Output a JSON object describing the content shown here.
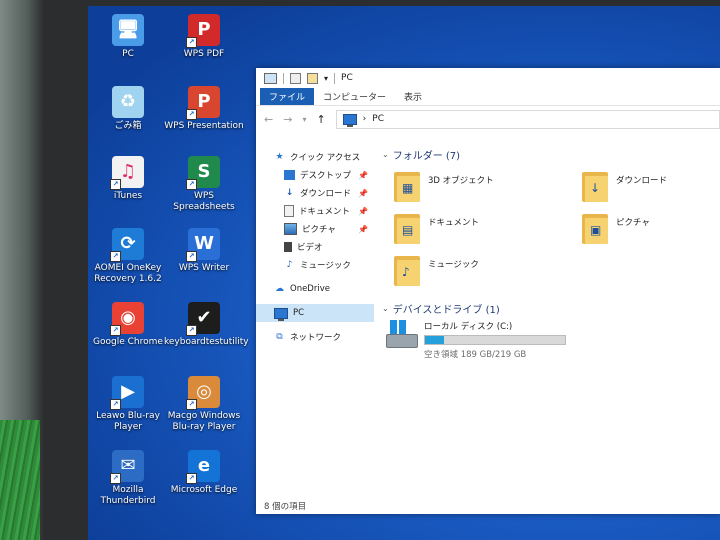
{
  "desktop": {
    "icons": [
      {
        "label": "PC",
        "icon": "pc-icon",
        "color": "#4a9be8",
        "glyph": "🖥",
        "shortcut": false
      },
      {
        "label": "WPS PDF",
        "icon": "wps-pdf-icon",
        "color": "#d22a2a",
        "glyph": "P",
        "shortcut": true
      },
      {
        "label": "ごみ箱",
        "icon": "recycle-bin-icon",
        "color": "#9fd3f0",
        "glyph": "♻",
        "shortcut": false
      },
      {
        "label": "WPS Presentation",
        "icon": "wps-presentation-icon",
        "color": "#d9462f",
        "glyph": "P",
        "shortcut": true
      },
      {
        "label": "iTunes",
        "icon": "itunes-icon",
        "color": "#f2f2f2",
        "glyph": "♫",
        "shortcut": true
      },
      {
        "label": "WPS Spreadsheets",
        "icon": "wps-spreadsheets-icon",
        "color": "#1f8a4c",
        "glyph": "S",
        "shortcut": true
      },
      {
        "label": "AOMEI OneKey\nRecovery 1.6.2",
        "icon": "aomei-recovery-icon",
        "color": "#1e7bd6",
        "glyph": "⟳",
        "shortcut": true
      },
      {
        "label": "WPS Writer",
        "icon": "wps-writer-icon",
        "color": "#2a6fd6",
        "glyph": "W",
        "shortcut": true
      },
      {
        "label": "Google Chrome",
        "icon": "google-chrome-icon",
        "color": "#e94235",
        "glyph": "◉",
        "shortcut": true
      },
      {
        "label": "keyboardtestutility",
        "icon": "keyboard-test-icon",
        "color": "#1d1d1d",
        "glyph": "✔",
        "shortcut": true
      },
      {
        "label": "Leawo Blu-ray\nPlayer",
        "icon": "leawo-player-icon",
        "color": "#1b6fd0",
        "glyph": "▶",
        "shortcut": true
      },
      {
        "label": "Macgo Windows\nBlu-ray Player",
        "icon": "macgo-player-icon",
        "color": "#d98a3a",
        "glyph": "◎",
        "shortcut": true
      },
      {
        "label": "Mozilla\nThunderbird",
        "icon": "thunderbird-icon",
        "color": "#2d6cc4",
        "glyph": "✉",
        "shortcut": true
      },
      {
        "label": "Microsoft Edge",
        "icon": "microsoft-edge-icon",
        "color": "#1473d6",
        "glyph": "e",
        "shortcut": true
      }
    ]
  },
  "window": {
    "title": "PC",
    "ribbon_tabs": [
      "ファイル",
      "コンピューター",
      "表示"
    ],
    "address": "PC",
    "address_separator": "›",
    "nav": {
      "quick_access": "クイック アクセス",
      "quick_items": [
        "デスクトップ",
        "ダウンロード",
        "ドキュメント",
        "ピクチャ",
        "ビデオ",
        "ミュージック"
      ],
      "onedrive": "OneDrive",
      "pc": "PC",
      "network": "ネットワーク"
    },
    "folders_header": "フォルダー (7)",
    "folders": [
      {
        "name": "3D オブジェクト",
        "icon": "3d-objects-folder-icon",
        "glyph": "▦"
      },
      {
        "name": "ダウンロード",
        "icon": "downloads-folder-icon",
        "glyph": "↓"
      },
      {
        "name": "ドキュメント",
        "icon": "documents-folder-icon",
        "glyph": "▤"
      },
      {
        "name": "ピクチャ",
        "icon": "pictures-folder-icon",
        "glyph": "▣"
      },
      {
        "name": "ミュージック",
        "icon": "music-folder-icon",
        "glyph": "♪"
      }
    ],
    "drives_header": "デバイスとドライブ (1)",
    "drive": {
      "name": "ローカル ディスク (C:)",
      "free_text": "空き領域 189 GB/219 GB",
      "used_fraction": 0.137
    },
    "status": "8 個の項目"
  }
}
